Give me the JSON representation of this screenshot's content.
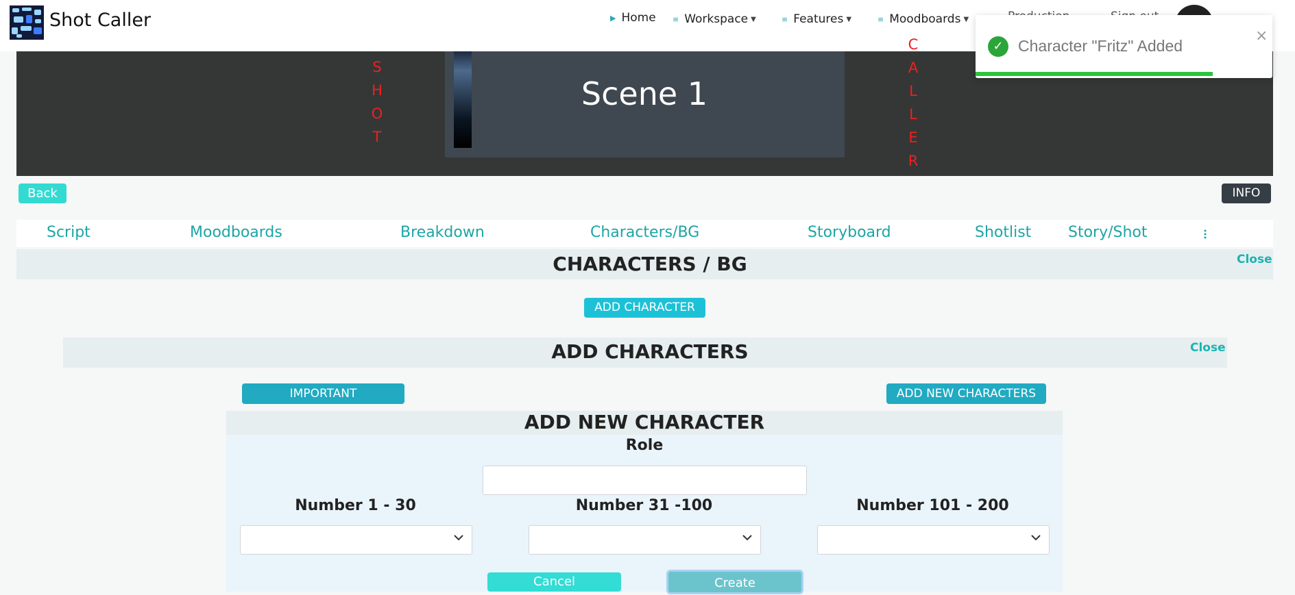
{
  "app": {
    "brand": "Shot Caller"
  },
  "nav": {
    "home": "Home",
    "workspace": "Workspace",
    "features": "Features",
    "moodboards": "Moodboards",
    "hidden_1": "Production",
    "hidden_2": "Sign out"
  },
  "banner": {
    "left_letters": [
      "S",
      "H",
      "O",
      "T"
    ],
    "right_letters": [
      "C",
      "A",
      "L",
      "L",
      "E",
      "R"
    ],
    "scene_title": "Scene 1"
  },
  "buttons": {
    "back": "Back",
    "info": "INFO"
  },
  "tabs": [
    "Script",
    "Moodboards",
    "Breakdown",
    "Characters/BG",
    "Storyboard",
    "Shotlist",
    "Story/Shot"
  ],
  "characters_section": {
    "title": "CHARACTERS / BG",
    "close": "Close",
    "add_character": "ADD CHARACTER"
  },
  "add_characters_section": {
    "title": "ADD CHARACTERS",
    "close": "Close",
    "important": "IMPORTANT",
    "add_new_characters": "ADD NEW CHARACTERS"
  },
  "form": {
    "title": "ADD NEW CHARACTER",
    "role_label": "Role",
    "role_value": "",
    "num1_label": "Number 1 - 30",
    "num2_label": "Number 31 -100",
    "num3_label": "Number 101 - 200",
    "cancel": "Cancel",
    "create": "Create"
  },
  "toast": {
    "message": "Character \"Fritz\" Added",
    "close": "×",
    "progress": 0.8
  },
  "colors": {
    "accent": "#1ca5a5",
    "banner": "#353737",
    "success": "#2bc43b",
    "banner_letters": "#ee2020"
  }
}
